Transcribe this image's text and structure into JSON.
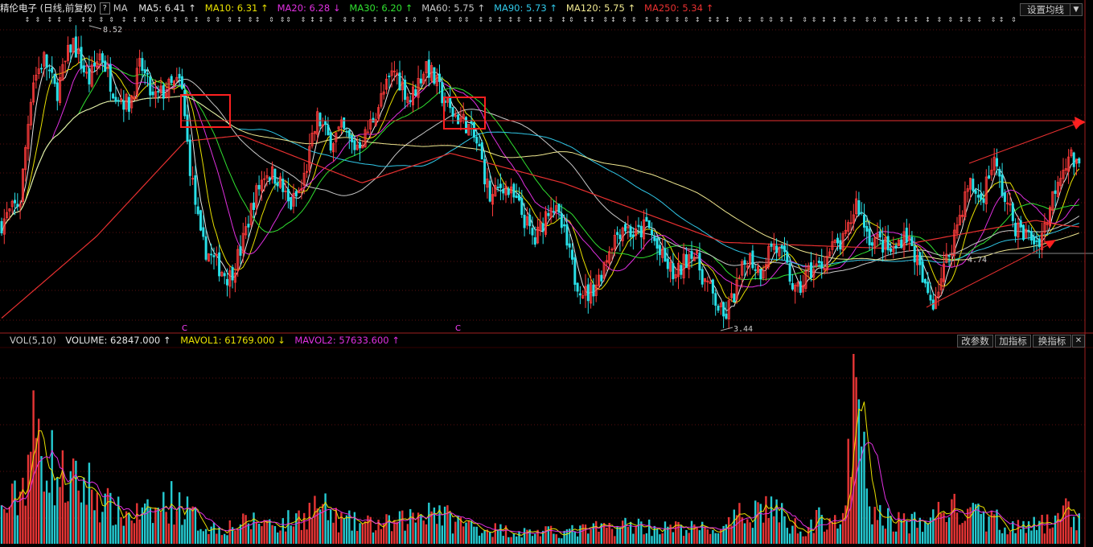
{
  "header": {
    "title": "精伦电子 (日线,前复权)",
    "help": "?",
    "ma_label": "MA",
    "ma_items": [
      {
        "label": "MA5: 6.41",
        "arrow": "↑",
        "color": "#e6e6e6"
      },
      {
        "label": "MA10: 6.31",
        "arrow": "↑",
        "color": "#e8e000"
      },
      {
        "label": "MA20: 6.28",
        "arrow": "↓",
        "color": "#e030e0"
      },
      {
        "label": "MA30: 6.20",
        "arrow": "↑",
        "color": "#30e030"
      },
      {
        "label": "MA60: 5.75",
        "arrow": "↑",
        "color": "#c8c8c8"
      },
      {
        "label": "MA90: 5.73",
        "arrow": "↑",
        "color": "#30c8e8"
      },
      {
        "label": "MA120: 5.75",
        "arrow": "↑",
        "color": "#f0e890"
      },
      {
        "label": "MA250: 5.34",
        "arrow": "↑",
        "color": "#e83030"
      }
    ],
    "settings_button": "设置均线"
  },
  "volume_header": {
    "label": "VOL(5,10)",
    "volume": "VOLUME: 62847.000",
    "volume_arrow": "↑",
    "mavol1": "MAVOL1: 61769.000",
    "mavol1_arrow": "↓",
    "mavol2": "MAVOL2: 57633.600",
    "mavol2_arrow": "↑",
    "buttons": [
      "改参数",
      "加指标",
      "换指标",
      "✕"
    ]
  },
  "chart_data": {
    "type": "candlestick",
    "title": "精伦电子 (日线,前复权)",
    "price_annotations": {
      "high": "8.52",
      "low": "3.44",
      "level": "4.74"
    },
    "marker_glyph": "C",
    "moving_averages": [
      "MA5",
      "MA10",
      "MA20",
      "MA30",
      "MA60",
      "MA90",
      "MA120",
      "MA250"
    ],
    "ma_colors": {
      "MA5": "#e6e6e6",
      "MA10": "#e8e000",
      "MA20": "#e030e0",
      "MA30": "#30e030",
      "MA60": "#c8c8c8",
      "MA90": "#30c8e8",
      "MA120": "#f0e890",
      "MA250": "#e83030"
    },
    "up_color": "#ff3b3b",
    "down_color": "#29e0e8",
    "price_range": [
      3.4,
      8.6
    ],
    "close_keyframes": [
      [
        0,
        5.2
      ],
      [
        25,
        5.6
      ],
      [
        40,
        7.6
      ],
      [
        55,
        8.0
      ],
      [
        70,
        7.4
      ],
      [
        90,
        8.3
      ],
      [
        110,
        7.6
      ],
      [
        125,
        8.1
      ],
      [
        140,
        7.5
      ],
      [
        160,
        7.2
      ],
      [
        175,
        7.9
      ],
      [
        190,
        7.3
      ],
      [
        210,
        7.5
      ],
      [
        225,
        7.6
      ],
      [
        235,
        6.3
      ],
      [
        250,
        4.9
      ],
      [
        265,
        4.6
      ],
      [
        285,
        4.3
      ],
      [
        300,
        4.8
      ],
      [
        315,
        5.6
      ],
      [
        330,
        6.1
      ],
      [
        345,
        6.0
      ],
      [
        360,
        5.5
      ],
      [
        375,
        5.8
      ],
      [
        395,
        7.0
      ],
      [
        410,
        6.6
      ],
      [
        425,
        6.8
      ],
      [
        440,
        6.5
      ],
      [
        455,
        6.7
      ],
      [
        470,
        7.2
      ],
      [
        490,
        7.8
      ],
      [
        510,
        7.3
      ],
      [
        530,
        7.9
      ],
      [
        545,
        7.5
      ],
      [
        560,
        7.1
      ],
      [
        580,
        6.9
      ],
      [
        595,
        6.5
      ],
      [
        610,
        5.6
      ],
      [
        625,
        5.9
      ],
      [
        645,
        5.5
      ],
      [
        665,
        4.9
      ],
      [
        685,
        5.6
      ],
      [
        700,
        5.1
      ],
      [
        715,
        4.3
      ],
      [
        730,
        4.0
      ],
      [
        745,
        4.3
      ],
      [
        760,
        4.9
      ],
      [
        775,
        5.2
      ],
      [
        790,
        5.0
      ],
      [
        805,
        5.2
      ],
      [
        820,
        4.7
      ],
      [
        840,
        4.3
      ],
      [
        860,
        4.8
      ],
      [
        875,
        4.3
      ],
      [
        890,
        3.9
      ],
      [
        900,
        3.6
      ],
      [
        915,
        4.1
      ],
      [
        930,
        4.7
      ],
      [
        945,
        4.4
      ],
      [
        960,
        4.9
      ],
      [
        975,
        4.6
      ],
      [
        990,
        4.0
      ],
      [
        1005,
        4.4
      ],
      [
        1020,
        4.5
      ],
      [
        1035,
        4.8
      ],
      [
        1050,
        4.9
      ],
      [
        1065,
        5.6
      ],
      [
        1080,
        5.0
      ],
      [
        1095,
        4.9
      ],
      [
        1110,
        4.7
      ],
      [
        1125,
        5.1
      ],
      [
        1140,
        4.6
      ],
      [
        1150,
        4.1
      ],
      [
        1160,
        3.9
      ],
      [
        1175,
        4.5
      ],
      [
        1190,
        5.2
      ],
      [
        1205,
        5.9
      ],
      [
        1220,
        5.6
      ],
      [
        1235,
        6.3
      ],
      [
        1250,
        5.6
      ],
      [
        1265,
        5.1
      ],
      [
        1280,
        5.0
      ],
      [
        1290,
        4.9
      ],
      [
        1300,
        5.2
      ],
      [
        1315,
        6.0
      ],
      [
        1330,
        6.4
      ],
      [
        1340,
        6.1
      ],
      [
        1350,
        6.3
      ]
    ],
    "volume_keyframes": [
      [
        0,
        0.15
      ],
      [
        25,
        0.25
      ],
      [
        40,
        0.55
      ],
      [
        55,
        0.5
      ],
      [
        70,
        0.35
      ],
      [
        90,
        0.3
      ],
      [
        110,
        0.3
      ],
      [
        130,
        0.2
      ],
      [
        150,
        0.15
      ],
      [
        170,
        0.15
      ],
      [
        190,
        0.15
      ],
      [
        210,
        0.22
      ],
      [
        225,
        0.2
      ],
      [
        250,
        0.1
      ],
      [
        270,
        0.08
      ],
      [
        300,
        0.1
      ],
      [
        320,
        0.12
      ],
      [
        350,
        0.1
      ],
      [
        380,
        0.15
      ],
      [
        395,
        0.2
      ],
      [
        420,
        0.12
      ],
      [
        450,
        0.1
      ],
      [
        490,
        0.1
      ],
      [
        520,
        0.15
      ],
      [
        535,
        0.2
      ],
      [
        560,
        0.12
      ],
      [
        600,
        0.08
      ],
      [
        650,
        0.06
      ],
      [
        700,
        0.06
      ],
      [
        750,
        0.08
      ],
      [
        790,
        0.1
      ],
      [
        820,
        0.08
      ],
      [
        860,
        0.08
      ],
      [
        900,
        0.07
      ],
      [
        920,
        0.14
      ],
      [
        940,
        0.18
      ],
      [
        960,
        0.2
      ],
      [
        980,
        0.1
      ],
      [
        1000,
        0.08
      ],
      [
        1030,
        0.15
      ],
      [
        1050,
        0.1
      ],
      [
        1063,
        0.8
      ],
      [
        1070,
        0.5
      ],
      [
        1085,
        0.15
      ],
      [
        1110,
        0.12
      ],
      [
        1150,
        0.1
      ],
      [
        1175,
        0.2
      ],
      [
        1195,
        0.15
      ],
      [
        1215,
        0.14
      ],
      [
        1240,
        0.12
      ],
      [
        1270,
        0.08
      ],
      [
        1300,
        0.1
      ],
      [
        1320,
        0.18
      ],
      [
        1340,
        0.12
      ],
      [
        1350,
        0.1
      ]
    ],
    "ylabel": "",
    "xlabel": ""
  }
}
